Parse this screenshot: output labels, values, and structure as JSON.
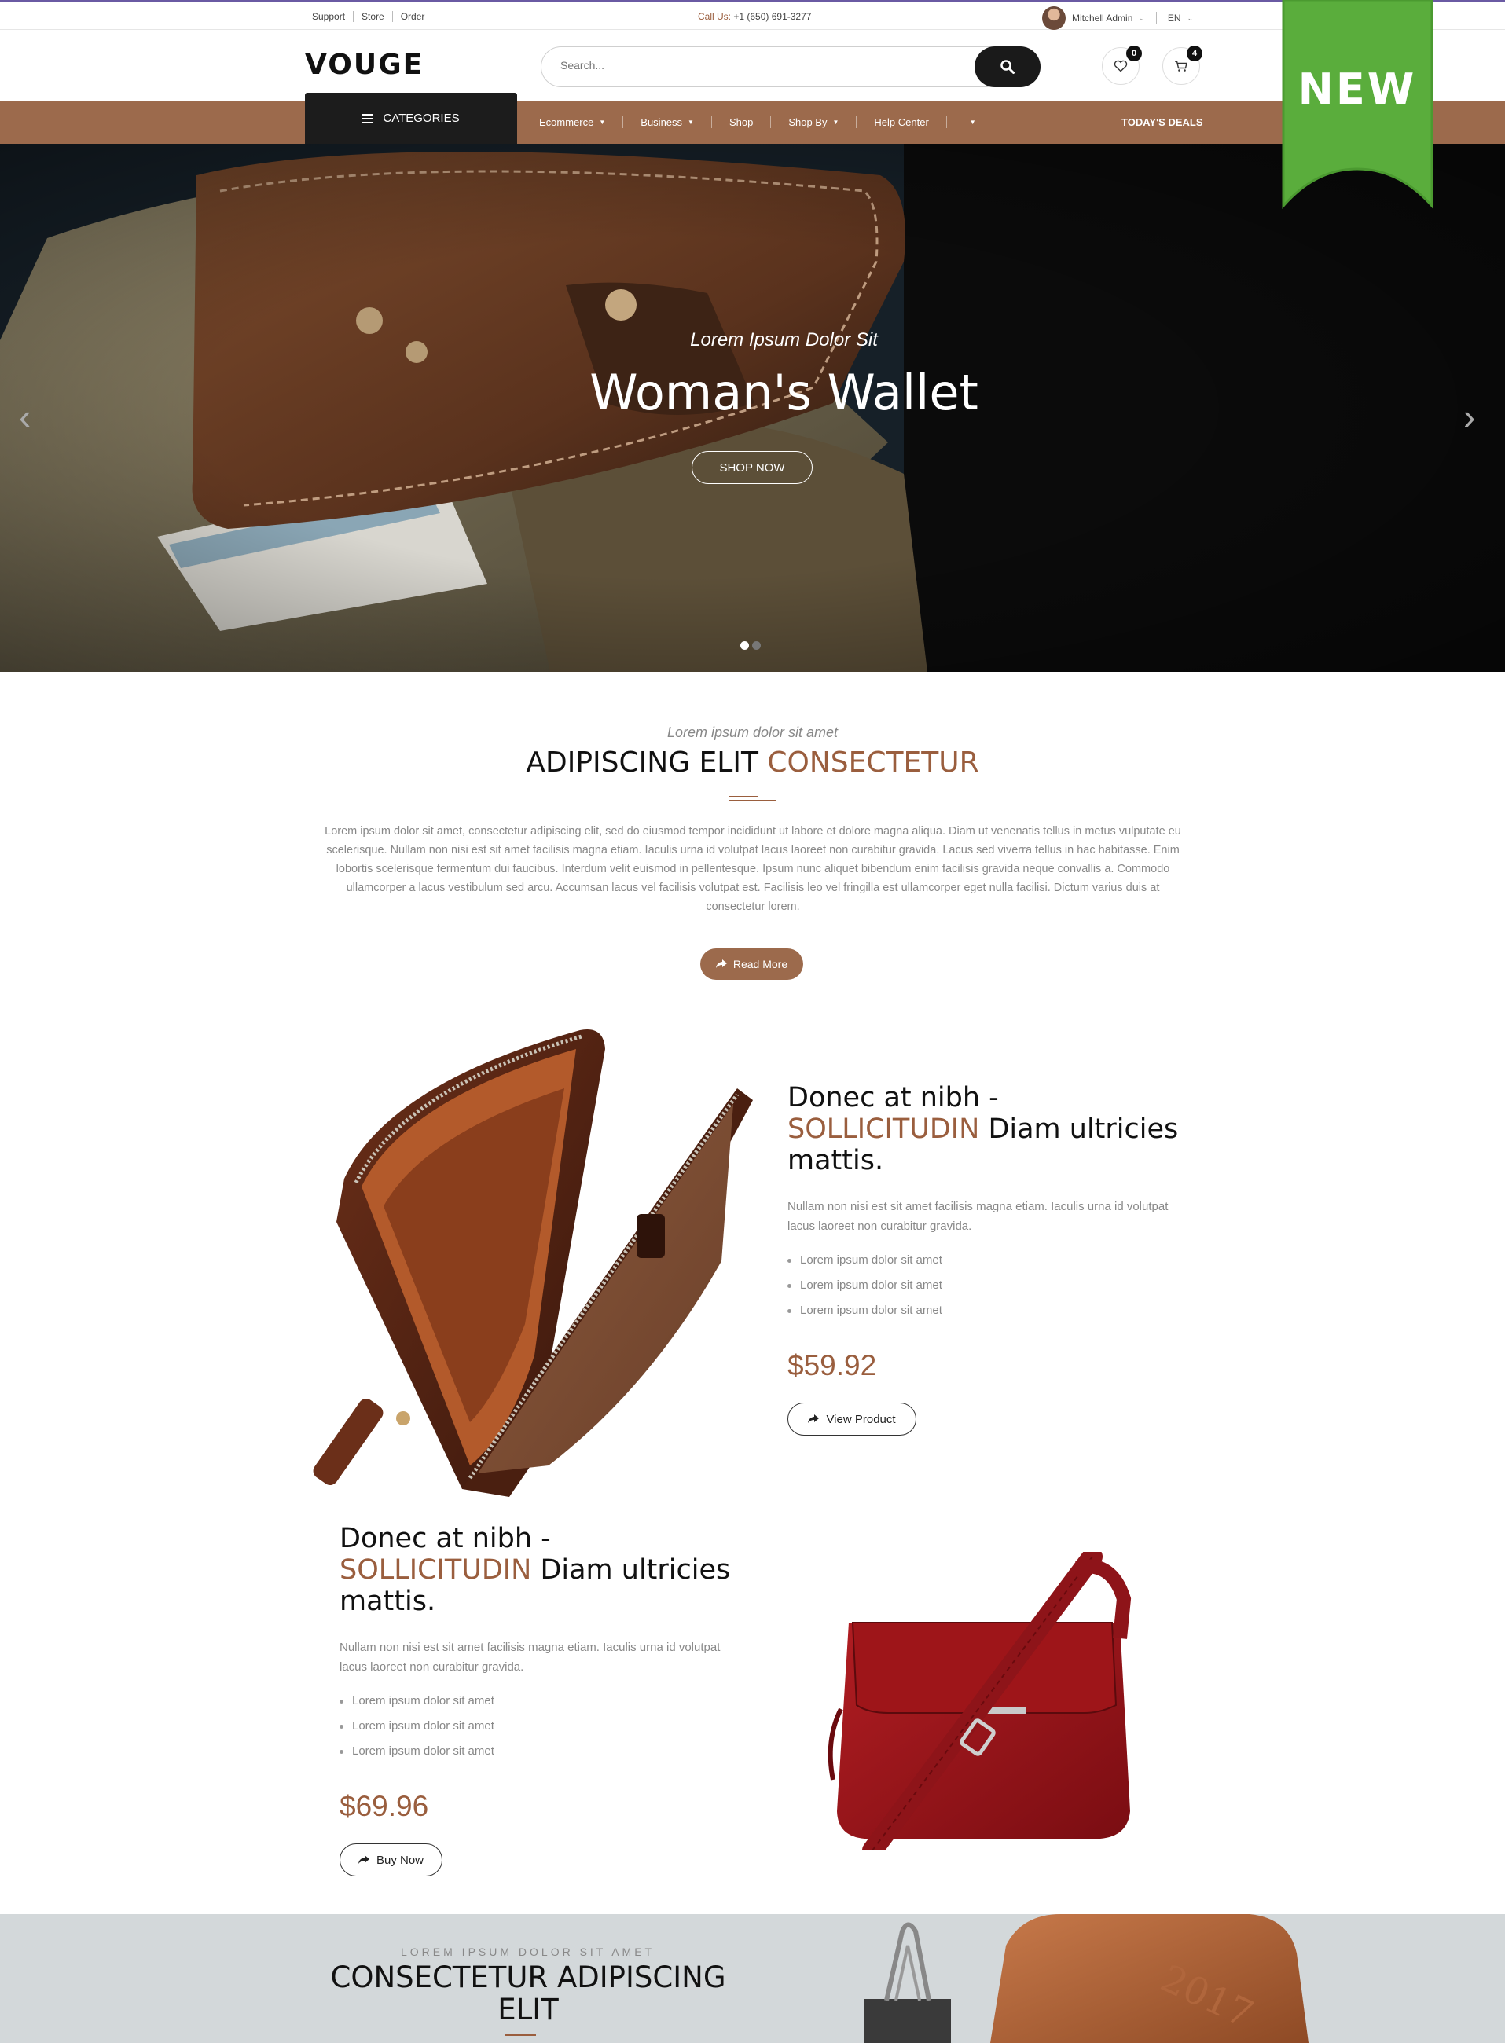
{
  "topbar": {
    "links": [
      "Support",
      "Store",
      "Order"
    ],
    "call_label": "Call Us:",
    "phone": "+1 (650) 691-3277",
    "user_name": "Mitchell Admin",
    "language": "EN"
  },
  "header": {
    "logo": "VOUGE",
    "search_placeholder": "Search...",
    "wishlist_count": "0",
    "cart_count": "4"
  },
  "nav": {
    "categories_label": "CATEGORIES",
    "items": [
      "Ecommerce",
      "Business",
      "Shop",
      "Shop By",
      "Help Center"
    ],
    "deals_label": "TODAY'S DEALS"
  },
  "ribbon": {
    "label": "NEW",
    "color": "#5aad3c"
  },
  "hero": {
    "subtitle": "Lorem Ipsum Dolor Sit",
    "title": "Woman's Wallet",
    "button": "SHOP NOW"
  },
  "intro": {
    "subtitle": "Lorem ipsum dolor sit amet",
    "title_main": "ADIPISCING ELIT",
    "title_accent": "CONSECTETUR",
    "body": "Lorem ipsum dolor sit amet, consectetur adipiscing elit, sed do eiusmod tempor incididunt ut labore et dolore magna aliqua. Diam ut venenatis tellus in metus vulputate eu scelerisque. Nullam non nisi est sit amet facilisis magna etiam. Iaculis urna id volutpat lacus laoreet non curabitur gravida. Lacus sed viverra tellus in hac habitasse. Enim lobortis scelerisque fermentum dui faucibus. Interdum velit euismod in pellentesque. Ipsum nunc aliquet bibendum enim facilisis gravida neque convallis a. Commodo ullamcorper a lacus vestibulum sed arcu. Accumsan lacus vel facilisis volutpat est. Facilisis leo vel fringilla est ullamcorper eget nulla facilisi. Dictum varius duis at consectetur lorem.",
    "button": "Read More"
  },
  "products": [
    {
      "title_a": "Donec at nibh -",
      "title_accent": "SOLLICITUDIN",
      "title_b": " Diam ultricies mattis.",
      "desc": "Nullam non nisi est sit amet facilisis magna etiam. Iaculis urna id volutpat lacus laoreet non curabitur gravida.",
      "bullets": [
        "Lorem ipsum dolor sit amet",
        "Lorem ipsum dolor sit amet",
        "Lorem ipsum dolor sit amet"
      ],
      "price": "$59.92",
      "button": "View Product"
    },
    {
      "title_a": "Donec at nibh -",
      "title_accent": "SOLLICITUDIN",
      "title_b": " Diam ultricies mattis.",
      "desc": "Nullam non nisi est sit amet facilisis magna etiam. Iaculis urna id volutpat lacus laoreet non curabitur gravida.",
      "bullets": [
        "Lorem ipsum dolor sit amet",
        "Lorem ipsum dolor sit amet",
        "Lorem ipsum dolor sit amet"
      ],
      "price": "$69.96",
      "button": "Buy Now"
    }
  ],
  "bottom": {
    "subtitle": "LOREM IPSUM DOLOR SIT AMET",
    "title_main": "CONSECTETUR",
    "title_accent": "ADIPISCING ELIT",
    "embossed": "2017"
  },
  "colors": {
    "brand_brown": "#9c6a4c",
    "accent_text": "#9a5e3e",
    "dark": "#1c1c1c"
  }
}
